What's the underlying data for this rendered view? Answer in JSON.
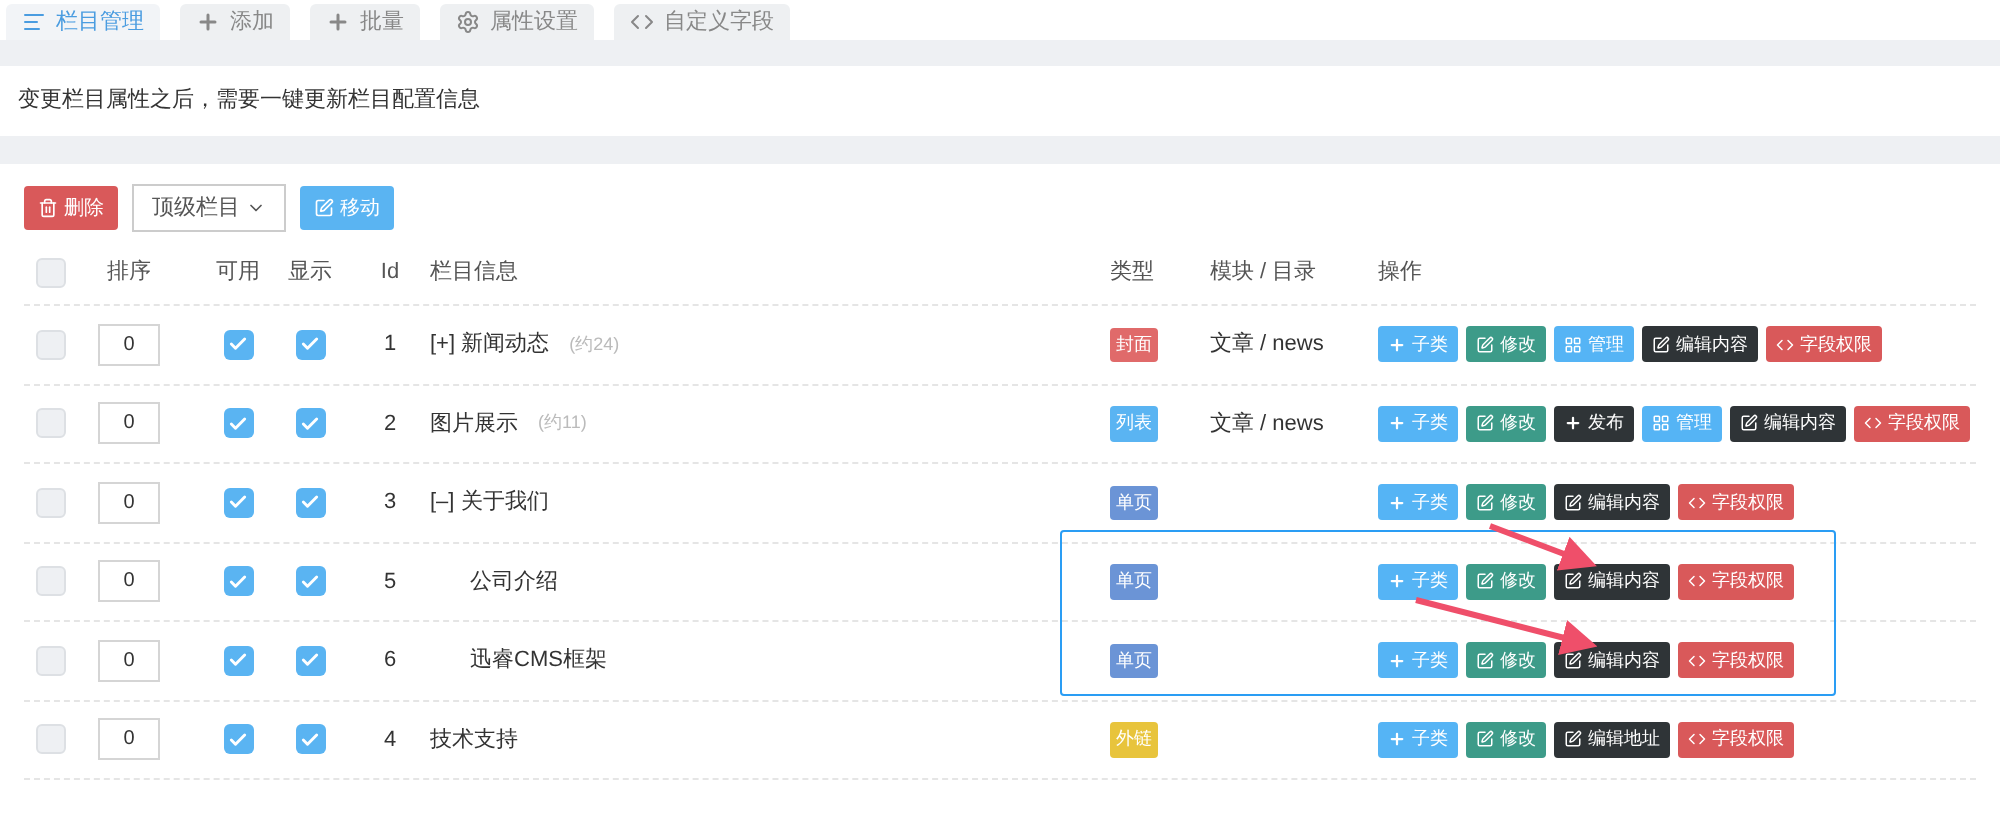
{
  "tabs": [
    {
      "label": "栏目管理",
      "selected": true
    },
    {
      "label": "添加",
      "selected": false
    },
    {
      "label": "批量",
      "selected": false
    },
    {
      "label": "属性设置",
      "selected": false
    },
    {
      "label": "自定义字段",
      "selected": false
    }
  ],
  "notice": "变更栏目属性之后，需要一键更新栏目配置信息",
  "toolbar": {
    "delete": "删除",
    "parent_select": "顶级栏目",
    "move": "移动"
  },
  "table": {
    "header_checked": false,
    "columns": [
      "排序",
      "可用",
      "显示",
      "Id",
      "栏目信息",
      "类型",
      "模块 / 目录",
      "操作"
    ],
    "rows": [
      {
        "checked": false,
        "sort": "0",
        "enabled": true,
        "visible": true,
        "id": "1",
        "name": "[+] 新闻动态",
        "count": "(约24)",
        "type": "封面",
        "color": "#e06a6a",
        "module": "文章 / news",
        "actions": [
          {
            "kind": "add",
            "label": "子类"
          },
          {
            "kind": "edit",
            "label": "修改"
          },
          {
            "kind": "manage",
            "label": "管理"
          },
          {
            "kind": "content",
            "label": "编辑内容"
          },
          {
            "kind": "field",
            "label": "字段权限"
          }
        ]
      },
      {
        "checked": false,
        "sort": "0",
        "enabled": true,
        "visible": true,
        "id": "2",
        "name": "图片展示",
        "count": "(约11)",
        "type": "列表",
        "color": "#5ab4f2",
        "module": "文章 / news",
        "actions": [
          {
            "kind": "add",
            "label": "子类"
          },
          {
            "kind": "edit",
            "label": "修改"
          },
          {
            "kind": "publish",
            "label": "发布"
          },
          {
            "kind": "manage",
            "label": "管理"
          },
          {
            "kind": "content",
            "label": "编辑内容"
          },
          {
            "kind": "field",
            "label": "字段权限"
          }
        ]
      },
      {
        "checked": false,
        "sort": "0",
        "enabled": true,
        "visible": true,
        "id": "3",
        "name": "[–] 关于我们",
        "type": "单页",
        "color": "#6b94d6",
        "actions": [
          {
            "kind": "add",
            "label": "子类"
          },
          {
            "kind": "edit",
            "label": "修改"
          },
          {
            "kind": "content",
            "label": "编辑内容"
          },
          {
            "kind": "field",
            "label": "字段权限"
          }
        ],
        "children": [
          {
            "checked": false,
            "sort": "0",
            "enabled": true,
            "visible": true,
            "id": "5",
            "name": "公司介绍",
            "type": "单页",
            "color": "#6b94d6",
            "actions": [
              {
                "kind": "add",
                "label": "子类"
              },
              {
                "kind": "edit",
                "label": "修改"
              },
              {
                "kind": "content",
                "label": "编辑内容"
              },
              {
                "kind": "field",
                "label": "字段权限"
              }
            ]
          },
          {
            "checked": false,
            "sort": "0",
            "enabled": true,
            "visible": true,
            "id": "6",
            "name": "迅睿CMS框架",
            "type": "单页",
            "color": "#6b94d6",
            "actions": [
              {
                "kind": "add",
                "label": "子类"
              },
              {
                "kind": "edit",
                "label": "修改"
              },
              {
                "kind": "content",
                "label": "编辑内容"
              },
              {
                "kind": "field",
                "label": "字段权限"
              }
            ]
          }
        ]
      },
      {
        "checked": false,
        "sort": "0",
        "enabled": true,
        "visible": true,
        "id": "4",
        "name": "技术支持",
        "type": "外链",
        "color": "#e8c43c",
        "actions": [
          {
            "kind": "add",
            "label": "子类"
          },
          {
            "kind": "edit",
            "label": "修改"
          },
          {
            "kind": "address",
            "label": "编辑地址"
          },
          {
            "kind": "field",
            "label": "字段权限"
          }
        ]
      }
    ]
  }
}
